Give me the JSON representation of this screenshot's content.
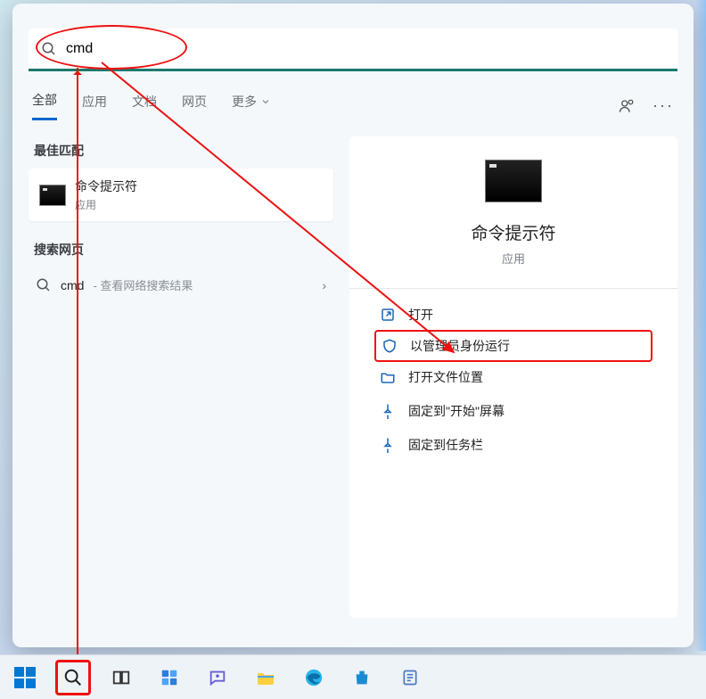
{
  "search": {
    "query": "cmd",
    "placeholder": ""
  },
  "tabs": {
    "all": "全部",
    "apps": "应用",
    "docs": "文档",
    "web": "网页",
    "more": "更多"
  },
  "left": {
    "best_match_heading": "最佳匹配",
    "best_match": {
      "title": "命令提示符",
      "subtitle": "应用"
    },
    "search_web_heading": "搜索网页",
    "web_result": {
      "label": "cmd",
      "suffix": " - 查看网络搜索结果"
    }
  },
  "preview": {
    "title": "命令提示符",
    "subtitle": "应用",
    "actions": {
      "open": "打开",
      "run_admin": "以管理员身份运行",
      "open_location": "打开文件位置",
      "pin_start": "固定到\"开始\"屏幕",
      "pin_taskbar": "固定到任务栏"
    }
  }
}
